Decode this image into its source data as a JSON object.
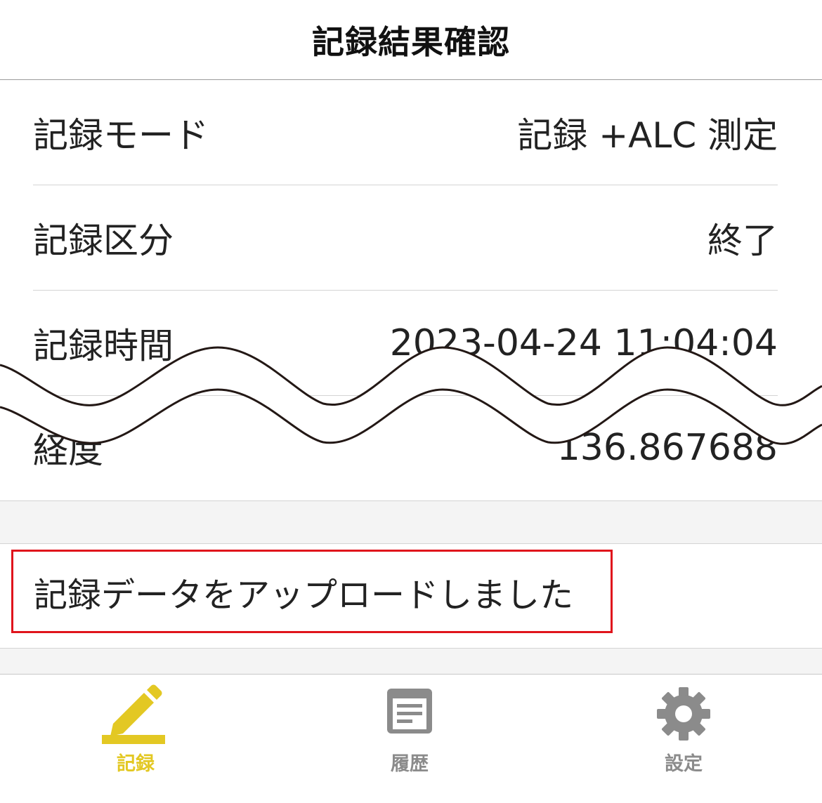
{
  "header": {
    "title": "記録結果確認"
  },
  "rows": [
    {
      "label": "記録モード",
      "value": "記録 +ALC 測定"
    },
    {
      "label": "記録区分",
      "value": "終了"
    },
    {
      "label": "記録時間",
      "value": "2023-04-24 11:04:04"
    },
    {
      "label": "経度",
      "value": "136.867688"
    }
  ],
  "message": {
    "text": "記録データをアップロードしました"
  },
  "tabbar": {
    "items": [
      {
        "label": "記録",
        "icon": "pencil-icon",
        "active": true
      },
      {
        "label": "履歴",
        "icon": "document-icon",
        "active": false
      },
      {
        "label": "設定",
        "icon": "gear-icon",
        "active": false
      }
    ]
  },
  "colors": {
    "accent": "#e3c823",
    "highlight_border": "#e0141c",
    "inactive": "#8b8b8b",
    "divider": "#d4d4d4"
  }
}
